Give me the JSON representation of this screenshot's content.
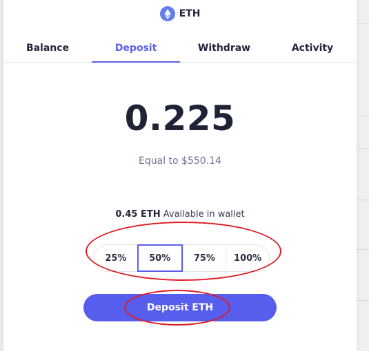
{
  "header": {
    "asset_symbol": "ETH",
    "icon": "ethereum-icon"
  },
  "tabs": [
    {
      "label": "Balance",
      "active": false
    },
    {
      "label": "Deposit",
      "active": true
    },
    {
      "label": "Withdraw",
      "active": false
    },
    {
      "label": "Activity",
      "active": false
    }
  ],
  "amount": {
    "value": "0.225",
    "equal_text": "Equal to $550.14"
  },
  "wallet": {
    "available_amount": "0.45 ETH",
    "available_text": " Available in wallet"
  },
  "percent_options": [
    {
      "label": "25%",
      "selected": false
    },
    {
      "label": "50%",
      "selected": true
    },
    {
      "label": "75%",
      "selected": false
    },
    {
      "label": "100%",
      "selected": false
    }
  ],
  "action": {
    "deposit_label": "Deposit ETH"
  },
  "colors": {
    "accent": "#5b60e6",
    "annotation": "#e01b24",
    "eth": "#627eea"
  }
}
